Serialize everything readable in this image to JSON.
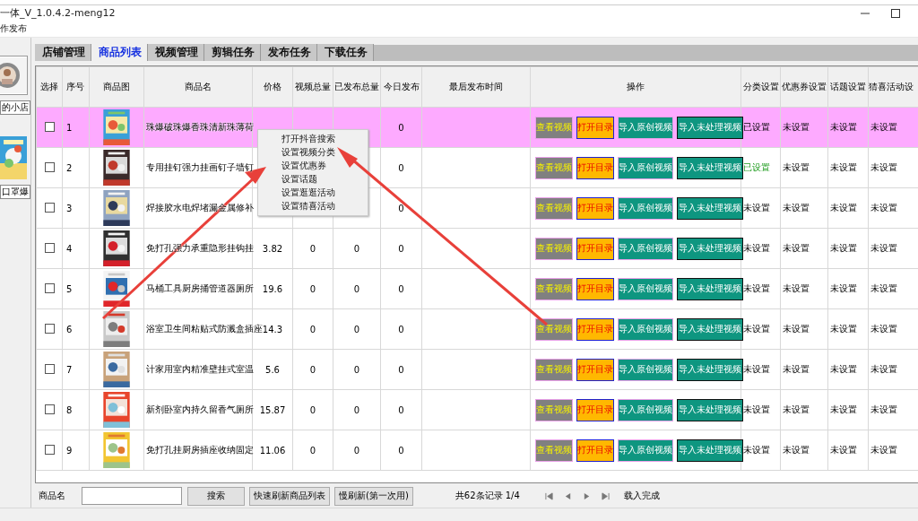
{
  "window": {
    "title": "一体_V_1.0.4.2-meng12"
  },
  "menu": [
    "作发布"
  ],
  "sidebar": {
    "shop_field": "的小店",
    "product_field": "口罩爆"
  },
  "tabs": [
    {
      "label": "店铺管理",
      "selected": false
    },
    {
      "label": "商品列表",
      "selected": true
    },
    {
      "label": "视频管理",
      "selected": false
    },
    {
      "label": "剪辑任务",
      "selected": false
    },
    {
      "label": "发布任务",
      "selected": false
    },
    {
      "label": "下载任务",
      "selected": false
    }
  ],
  "table": {
    "columns": [
      "选择",
      "序号",
      "商品图",
      "商品名",
      "价格",
      "视频总量",
      "已发布总量",
      "今日发布",
      "最后发布时间",
      "操作",
      "分类设置",
      "优惠券设置",
      "话题设置",
      "猜喜活动设"
    ],
    "rows": [
      {
        "checked": false,
        "selected": true,
        "index": "1",
        "name": "珠爆破珠爆香珠清新珠薄荷",
        "today": "0",
        "actions": [
          "查看视频",
          "打开目录",
          "导入原创视频",
          "导入未处理视频"
        ],
        "category": "已设置",
        "category_set": true,
        "coupon": "未设置",
        "topic": "未设置",
        "activity": "未设置"
      },
      {
        "checked": false,
        "selected": false,
        "index": "2",
        "name": "专用挂钉强力挂画钉子墙钉",
        "today": "0",
        "actions": [
          "查看视频",
          "打开目录",
          "导入原创视频",
          "导入未处理视频"
        ],
        "category": "已设置",
        "category_set": true,
        "coupon": "未设置",
        "topic": "未设置",
        "activity": "未设置"
      },
      {
        "checked": false,
        "selected": false,
        "index": "3",
        "name": "焊接胶水电焊堵漏金属修补",
        "today": "0",
        "actions": [
          "查看视频",
          "打开目录",
          "导入原创视频",
          "导入未处理视频"
        ],
        "category": "未设置",
        "category_set": false,
        "coupon": "未设置",
        "topic": "未设置",
        "activity": "未设置"
      },
      {
        "checked": false,
        "selected": false,
        "index": "4",
        "name": "免打孔强力承重隐形挂钩挂",
        "price": "3.82",
        "videos": "0",
        "published": "0",
        "today": "0",
        "actions": [
          "查看视频",
          "打开目录",
          "导入原创视频",
          "导入未处理视频"
        ],
        "category": "未设置",
        "category_set": false,
        "coupon": "未设置",
        "topic": "未设置",
        "activity": "未设置"
      },
      {
        "checked": false,
        "selected": false,
        "index": "5",
        "name": "马桶工具厨房捅管道器厕所",
        "price": "19.6",
        "videos": "0",
        "published": "0",
        "today": "0",
        "actions": [
          "查看视频",
          "打开目录",
          "导入原创视频",
          "导入未处理视频"
        ],
        "category": "未设置",
        "category_set": false,
        "coupon": "未设置",
        "topic": "未设置",
        "activity": "未设置"
      },
      {
        "checked": false,
        "selected": false,
        "index": "6",
        "name": "浴室卫生间粘贴式防溅盒插座",
        "price": "14.3",
        "videos": "0",
        "published": "0",
        "today": "0",
        "actions": [
          "查看视频",
          "打开目录",
          "导入原创视频",
          "导入未处理视频"
        ],
        "category": "未设置",
        "category_set": false,
        "coupon": "未设置",
        "topic": "未设置",
        "activity": "未设置"
      },
      {
        "checked": false,
        "selected": false,
        "index": "7",
        "name": "计家用室内精准壁挂式室温",
        "price": "5.6",
        "videos": "0",
        "published": "0",
        "today": "0",
        "actions": [
          "查看视频",
          "打开目录",
          "导入原创视频",
          "导入未处理视频"
        ],
        "category": "未设置",
        "category_set": false,
        "coupon": "未设置",
        "topic": "未设置",
        "activity": "未设置"
      },
      {
        "checked": false,
        "selected": false,
        "index": "8",
        "name": "新剂卧室内持久留香气厕所",
        "price": "15.87",
        "videos": "0",
        "published": "0",
        "today": "0",
        "actions": [
          "查看视频",
          "打开目录",
          "导入原创视频",
          "导入未处理视频"
        ],
        "category": "未设置",
        "category_set": false,
        "coupon": "未设置",
        "topic": "未设置",
        "activity": "未设置"
      },
      {
        "checked": false,
        "selected": false,
        "index": "9",
        "name": "免打孔挂厨房插座收纳固定",
        "price": "11.06",
        "videos": "0",
        "published": "0",
        "today": "0",
        "actions": [
          "查看视频",
          "打开目录",
          "导入原创视频",
          "导入未处理视频"
        ],
        "category": "未设置",
        "category_set": false,
        "coupon": "未设置",
        "topic": "未设置",
        "activity": "未设置"
      }
    ]
  },
  "context_menu": [
    "打开抖音搜索",
    "设置视频分类",
    "设置优惠券",
    "设置话题",
    "设置逛逛活动",
    "设置猜喜活动"
  ],
  "footer": {
    "search_label": "商品名",
    "search_button": "搜索",
    "fast_refresh": "快速刷新商品列表",
    "slow_refresh": "慢刷新(第一次用)",
    "records": "共62条记录 1/4",
    "status": "载入完成"
  }
}
